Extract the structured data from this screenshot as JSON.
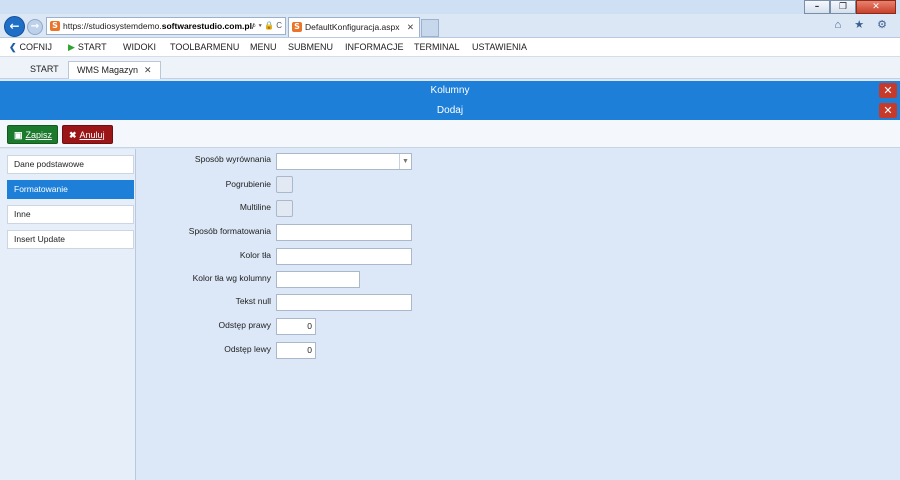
{
  "window": {
    "minimize": "–",
    "maximize": "❐",
    "close": "✕"
  },
  "browser": {
    "url_prefix": "https://studiosystemdemo.",
    "url_domain": "softwarestudio.com.pl",
    "url_suffix": "/",
    "url_icons": "⌕ ▾ 🔒 C",
    "tab_title": "DefaultKonfiguracja.aspx",
    "tab_close": "✕",
    "tool_icons": "⌂ ★ ⚙"
  },
  "menu": {
    "back": "COFNIJ",
    "start": "START",
    "items": [
      "WIDOKI",
      "TOOLBARMENU",
      "MENU",
      "SUBMENU",
      "INFORMACJE",
      "TERMINAL",
      "USTAWIENIA"
    ]
  },
  "page_tabs": {
    "start": "START",
    "active": "WMS Magazyn",
    "close": "✕"
  },
  "bars": {
    "top": "Kolumny",
    "second": "Dodaj"
  },
  "toolbar": {
    "save": "Zapisz",
    "cancel": "Anuluj"
  },
  "sidebar": {
    "items": [
      "Dane podstawowe",
      "Formatowanie",
      "Inne",
      "Insert Update"
    ]
  },
  "form": {
    "alignment_label": "Sposób wyrównania",
    "alignment_value": "",
    "bold_label": "Pogrubienie",
    "multiline_label": "Multiline",
    "format_label": "Sposób formatowania",
    "format_value": "",
    "bgcolor_label": "Kolor tła",
    "bgcolor_value": "",
    "bgcolor_col_label": "Kolor tła wg kolumny",
    "bgcolor_col_value": "",
    "textnull_label": "Tekst null",
    "textnull_value": "",
    "right_gap_label": "Odstęp prawy",
    "right_gap_value": "0",
    "left_gap_label": "Odstęp lewy",
    "left_gap_value": "0"
  },
  "colors": {
    "accent": "#1e7fd8",
    "save": "#1c7a2c",
    "cancel": "#9b1717"
  }
}
